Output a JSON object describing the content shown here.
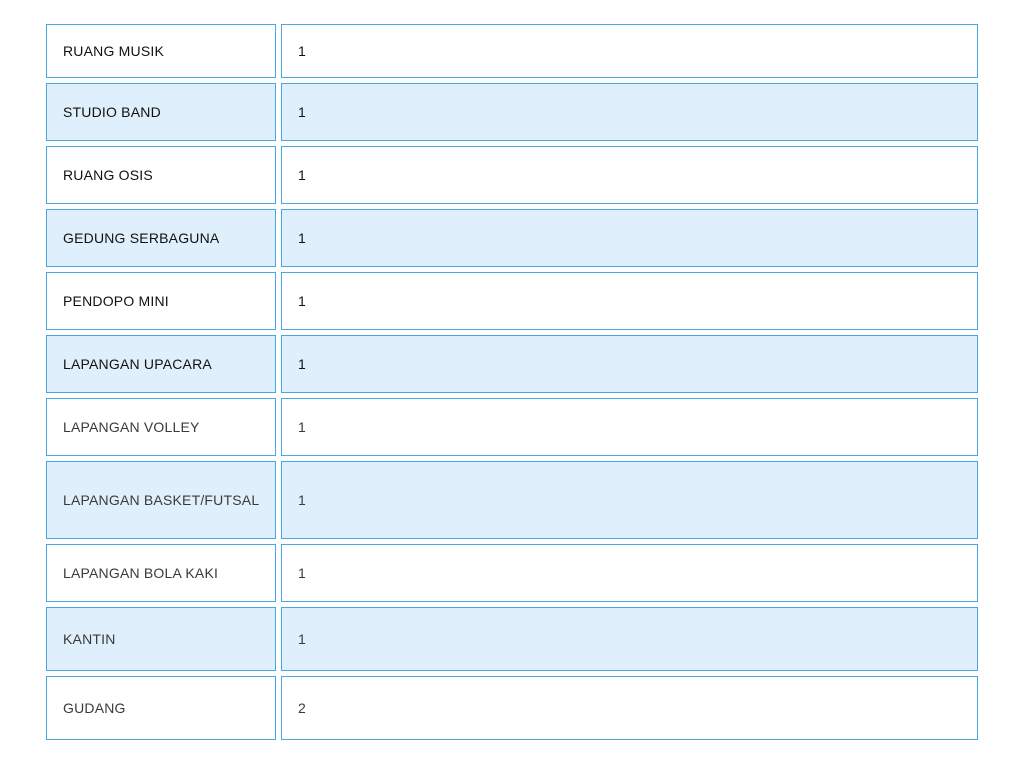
{
  "table": {
    "rows": [
      {
        "name": "RUANG MUSIK",
        "value": "1"
      },
      {
        "name": "STUDIO BAND",
        "value": "1"
      },
      {
        "name": "RUANG OSIS",
        "value": "1"
      },
      {
        "name": "GEDUNG SERBAGUNA",
        "value": "1"
      },
      {
        "name": "PENDOPO MINI",
        "value": "1"
      },
      {
        "name": "LAPANGAN UPACARA",
        "value": "1"
      },
      {
        "name": "LAPANGAN VOLLEY",
        "value": "1"
      },
      {
        "name": "LAPANGAN BASKET/FUTSAL",
        "value": "1"
      },
      {
        "name": "LAPANGAN BOLA KAKI",
        "value": "1"
      },
      {
        "name": "KANTIN",
        "value": "1"
      },
      {
        "name": "GUDANG",
        "value": "2"
      }
    ]
  },
  "colors": {
    "border": "#4aa6e0",
    "alt_row_bg": "#dff0fc"
  }
}
